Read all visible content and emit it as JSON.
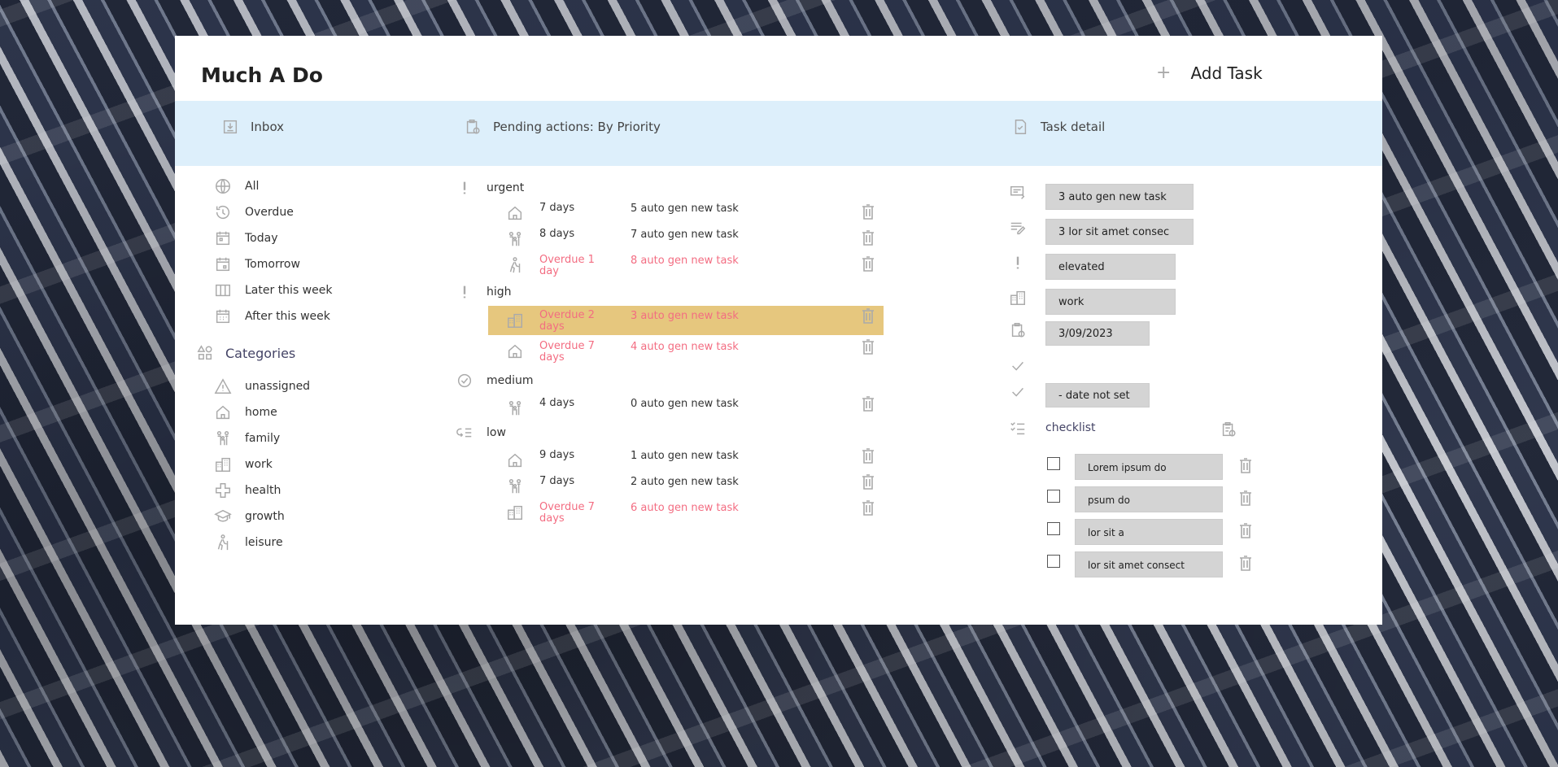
{
  "app": {
    "title": "Much A Do",
    "add_task_label": "Add Task"
  },
  "bar": {
    "inbox_label": "Inbox",
    "pending_label": "Pending actions: By Priority",
    "detail_label": "Task detail"
  },
  "nav": {
    "items": [
      {
        "label": "All",
        "icon": "globe-icon"
      },
      {
        "label": "Overdue",
        "icon": "history-icon"
      },
      {
        "label": "Today",
        "icon": "calendar-today-icon"
      },
      {
        "label": "Tomorrow",
        "icon": "calendar-tomorrow-icon"
      },
      {
        "label": "Later this week",
        "icon": "columns-icon"
      },
      {
        "label": "After this week",
        "icon": "calendar-month-icon"
      }
    ],
    "categories_label": "Categories",
    "categories": [
      {
        "label": "unassigned",
        "icon": "warning-icon"
      },
      {
        "label": "home",
        "icon": "home-icon"
      },
      {
        "label": "family",
        "icon": "family-icon"
      },
      {
        "label": "work",
        "icon": "building-icon"
      },
      {
        "label": "health",
        "icon": "health-cross-icon"
      },
      {
        "label": "growth",
        "icon": "graduation-cap-icon"
      },
      {
        "label": "leisure",
        "icon": "hiking-icon"
      }
    ]
  },
  "groups": [
    {
      "label": "urgent",
      "icon": "exclamation-icon"
    },
    {
      "label": "high",
      "icon": "exclamation-icon"
    },
    {
      "label": "medium",
      "icon": "check-circle-icon"
    },
    {
      "label": "low",
      "icon": "low-priority-icon"
    }
  ],
  "tasks": [
    {
      "when": "7 days",
      "name": "5 auto gen new task",
      "icon": "home-icon",
      "overdue": false
    },
    {
      "when": "8 days",
      "name": "7 auto gen new task",
      "icon": "family-icon",
      "overdue": false
    },
    {
      "when": "Overdue 1 day",
      "name": "8 auto gen new task",
      "icon": "hiking-icon",
      "overdue": true
    },
    {
      "when": "Overdue 2 days",
      "name": "3 auto gen new task",
      "icon": "building-icon",
      "overdue": true,
      "selected": true
    },
    {
      "when": "Overdue 7 days",
      "name": "4 auto gen new task",
      "icon": "home-icon",
      "overdue": true
    },
    {
      "when": "4 days",
      "name": "0 auto gen new task",
      "icon": "family-icon",
      "overdue": false
    },
    {
      "when": "9 days",
      "name": "1 auto gen new task",
      "icon": "home-icon",
      "overdue": false
    },
    {
      "when": "7 days",
      "name": "2 auto gen new task",
      "icon": "family-icon",
      "overdue": false
    },
    {
      "when": "Overdue 7 days",
      "name": "6 auto gen new task",
      "icon": "building-icon",
      "overdue": true
    }
  ],
  "detail": {
    "title": "3 auto gen new task",
    "notes": "3 lor sit amet consec",
    "priority": "elevated",
    "category": "work",
    "due_date": "3/09/2023",
    "completed_date": "- date not set",
    "checklist_label": "checklist",
    "checklist": [
      {
        "text": "Lorem ipsum do",
        "checked": false
      },
      {
        "text": "psum do",
        "checked": false
      },
      {
        "text": "lor sit a",
        "checked": false
      },
      {
        "text": "lor sit amet consect",
        "checked": false
      }
    ]
  },
  "colors": {
    "bar_bg": "#ddeffb",
    "overdue": "#f36d82",
    "selected_row": "#e6c77e",
    "field_bg": "#d4d4d4",
    "icon_gray": "#aaaaaa"
  }
}
